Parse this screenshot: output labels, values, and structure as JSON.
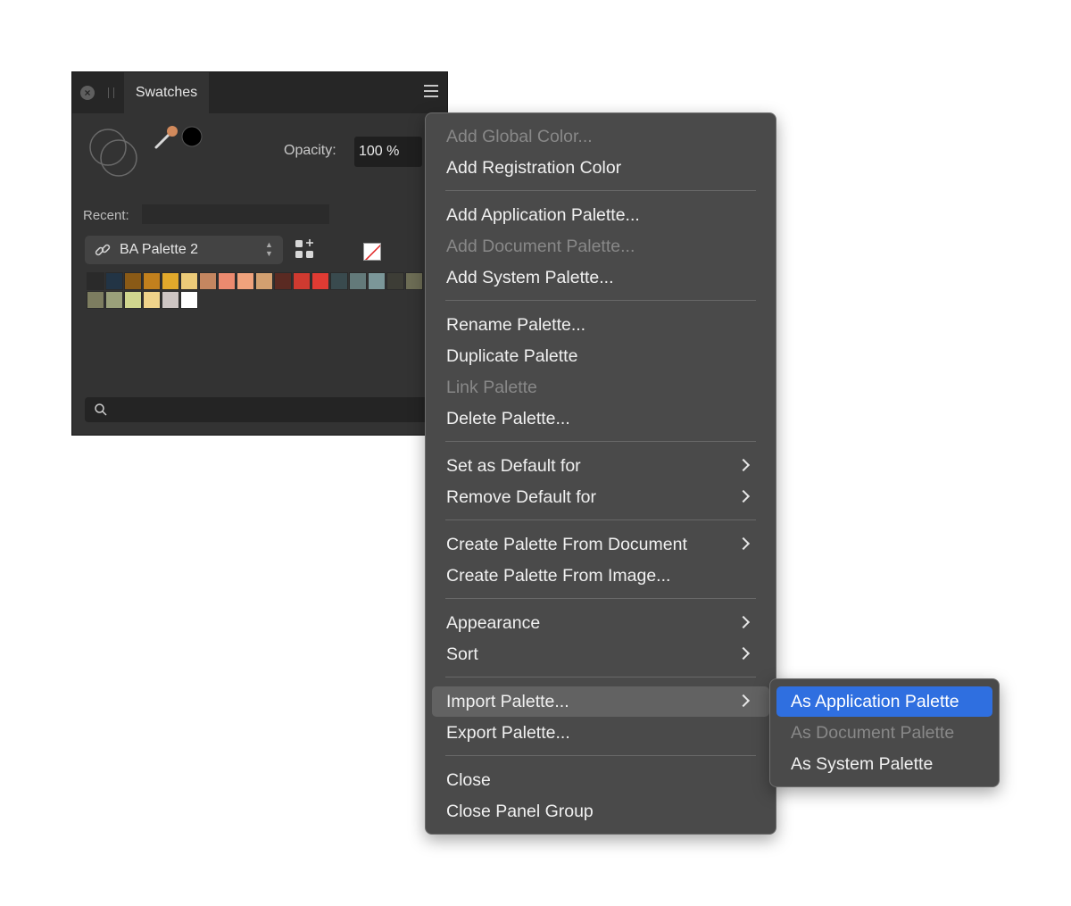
{
  "panel": {
    "tab_label": "Swatches",
    "opacity_label": "Opacity:",
    "opacity_value": "100 %",
    "recent_label": "Recent:",
    "palette_name": "BA Palette 2",
    "current_fill_color": "#000000",
    "swatches_row1": [
      "#2a2a2a",
      "#223445",
      "#8a5a16",
      "#c2801d",
      "#e2a92b",
      "#eccb78",
      "#c48660",
      "#ec8a6f",
      "#f0a27c",
      "#d3a070",
      "#5a2a22",
      "#cf3a30",
      "#e03b33",
      "#394a4e",
      "#637a7a",
      "#7b9799",
      "#3d3d36",
      "#6d6d55"
    ],
    "swatches_row2": [
      "#7d7d60",
      "#9aa07a",
      "#d0d68e",
      "#efd38a",
      "#cdc5c3",
      "#ffffff"
    ]
  },
  "menu": {
    "items": [
      {
        "label": "Add Global Color...",
        "disabled": true
      },
      {
        "label": "Add Registration Color"
      },
      {
        "label": "Add Application Palette..."
      },
      {
        "label": "Add Document Palette...",
        "disabled": true
      },
      {
        "label": "Add System Palette..."
      },
      {
        "label": "Rename Palette..."
      },
      {
        "label": "Duplicate Palette"
      },
      {
        "label": "Link Palette",
        "disabled": true
      },
      {
        "label": "Delete Palette..."
      },
      {
        "label": "Set as Default for",
        "submenu": true
      },
      {
        "label": "Remove Default for",
        "submenu": true
      },
      {
        "label": "Create Palette From Document",
        "submenu": true
      },
      {
        "label": "Create Palette From Image..."
      },
      {
        "label": "Appearance",
        "submenu": true
      },
      {
        "label": "Sort",
        "submenu": true
      },
      {
        "label": "Import Palette...",
        "submenu": true,
        "highlighted": true
      },
      {
        "label": "Export Palette..."
      },
      {
        "label": "Close"
      },
      {
        "label": "Close Panel Group"
      }
    ]
  },
  "submenu": {
    "items": [
      {
        "label": "As Application Palette",
        "selected": true
      },
      {
        "label": "As Document Palette",
        "disabled": true
      },
      {
        "label": "As System Palette"
      }
    ]
  },
  "colors": {
    "highlight": "#2f6fe0",
    "menu_bg": "#4a4a4a",
    "panel_bg": "#333333"
  }
}
